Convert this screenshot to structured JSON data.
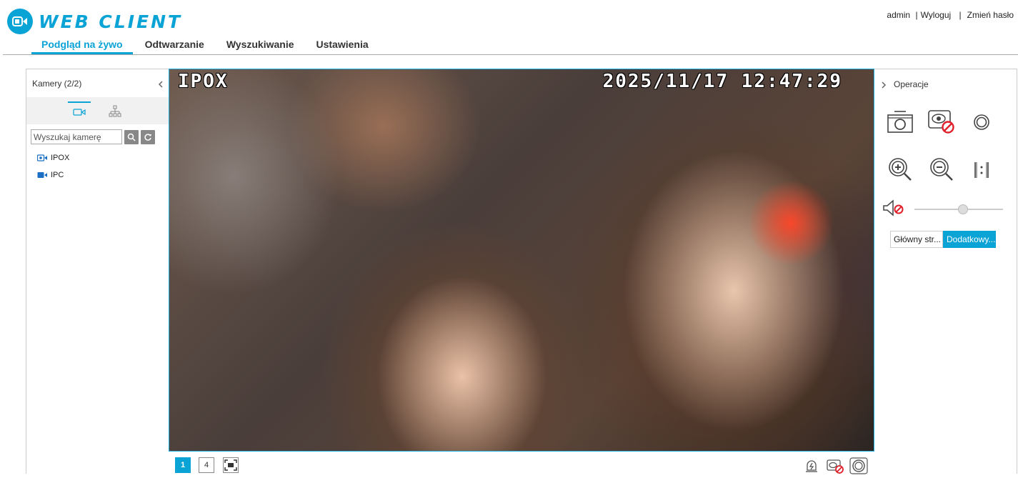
{
  "app": {
    "title": "WEB CLIENT",
    "accent": "#0aa3d6"
  },
  "user": {
    "name": "admin",
    "sep": "|",
    "logout": "Wyloguj",
    "sep2": "|",
    "change_password": "Zmień hasło"
  },
  "nav": {
    "tabs": [
      {
        "label": "Podgląd na żywo",
        "active": true
      },
      {
        "label": "Odtwarzanie"
      },
      {
        "label": "Wyszukiwanie"
      },
      {
        "label": "Ustawienia"
      }
    ]
  },
  "left_panel": {
    "title": "Kamery (2/2)",
    "search": {
      "placeholder": "Wyszukaj kamerę",
      "value": ""
    },
    "tabs": [
      {
        "icon": "camera-list-icon",
        "active": true
      },
      {
        "icon": "device-tree-icon"
      }
    ],
    "cameras": [
      {
        "name": "IPOX",
        "icon": "camera-active-icon"
      },
      {
        "name": "IPC",
        "icon": "camera-icon"
      }
    ]
  },
  "video": {
    "osd_name": "IPOX",
    "osd_datetime": "2025/11/17 12:47:29"
  },
  "bottom_bar": {
    "layout_1": "1",
    "layout_4": "4",
    "icons": [
      "fullscreen-icon",
      "alarm-icon",
      "stop-record-icon",
      "stop-all-icon"
    ]
  },
  "right_panel": {
    "title": "Operacje",
    "icons": [
      "snapshot-icon",
      "stop-record-icon",
      "close-preview-icon",
      "zoom-in-icon",
      "zoom-out-icon",
      "original-size-icon",
      "mute-icon"
    ],
    "volume": 0.55,
    "stream_main": "Główny str...",
    "stream_sub": "Dodatkowy...",
    "active_stream": "sub"
  }
}
